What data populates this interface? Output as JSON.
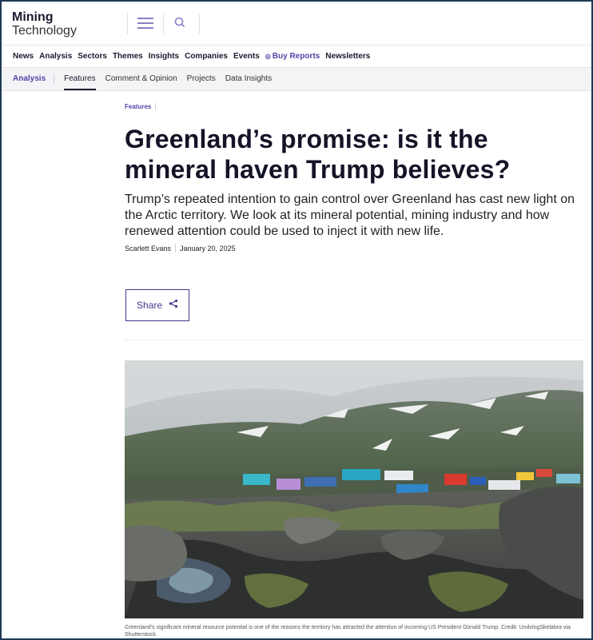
{
  "site": {
    "logo_line1": "Mining",
    "logo_line2": "Technology"
  },
  "header": {
    "menu_icon": "hamburger-menu-icon",
    "search_icon": "search-icon"
  },
  "primary_nav": [
    "News",
    "Analysis",
    "Sectors",
    "Themes",
    "Insights",
    "Companies",
    "Events",
    "Buy Reports",
    "Newsletters"
  ],
  "sub_nav": [
    "Analysis",
    "Features",
    "Comment & Opinion",
    "Projects",
    "Data Insights"
  ],
  "sub_nav_active": "Features",
  "article": {
    "kicker": "Features",
    "title": "Greenland’s promise: is it the mineral haven Trump believes?",
    "standfirst": "Trump’s repeated intention to gain control over Greenland has cast new light on the Arctic territory. We look at its mineral potential, mining industry and how renewed attention could be used to inject it with new life.",
    "author": "Scarlett Evans",
    "date": "January 20, 2025",
    "share_label": "Share",
    "caption": "Greenland’s significant mineral resource potential is one of the reasons the territory has attracted the attention of incoming US President Donald Trump. Credit: UndvingSkelabra via Shutterstock."
  },
  "colors": {
    "accent": "#5046a8",
    "text": "#141428",
    "frame": "#1e3a52"
  }
}
